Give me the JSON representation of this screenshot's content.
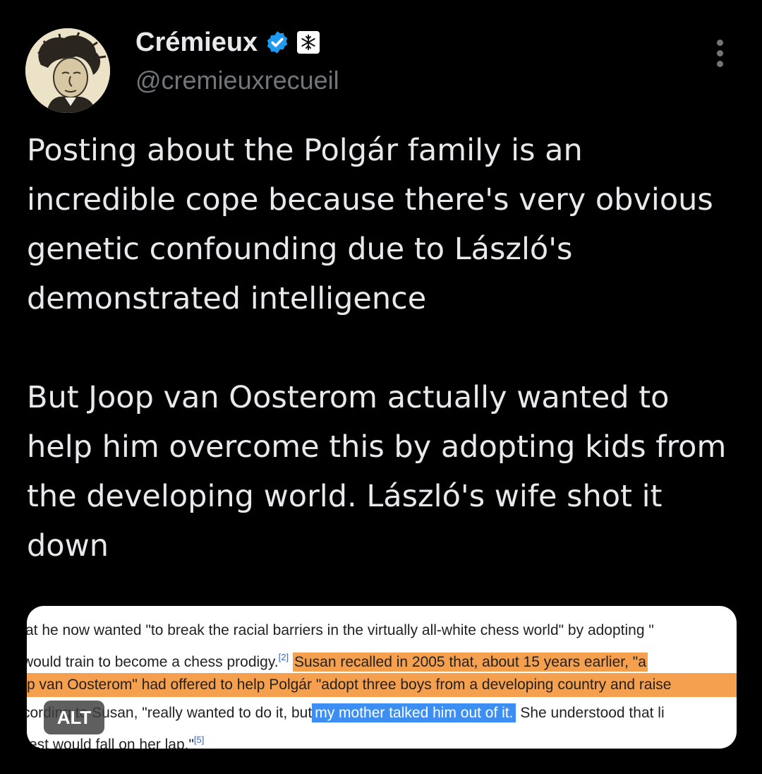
{
  "author": {
    "name": "Crémieux",
    "handle": "@cremieuxrecueil",
    "verified_color": "#1d9bf0",
    "avatar_icon": "caricature-portrait",
    "affiliation_icon": "snowflake-badge-icon"
  },
  "menu_icon": "more-vertical-icon",
  "tweet": {
    "paragraph1": "Posting about the Polgár family is an incredible cope because there's very obvious genetic confounding due to László's demonstrated intelligence",
    "paragraph2": "But Joop van Oosterom actually wanted to help him overcome this by adopting kids from the developing world. László's wife shot it down"
  },
  "media": {
    "alt_badge": "ALT",
    "highlight_orange": "#f5a04f",
    "highlight_blue": "#3d8ef2",
    "lines": {
      "l1": "at he now wanted \"to break the racial barriers in the virtually all-white chess world\" by adopting \"",
      "l2_plain": " would train to become a chess prodigy.",
      "l2_ref": "[2]",
      "l2_highlight": "Susan recalled in 2005 that, about 15 years earlier, \"a",
      "l3": "p van Oosterom\" had offered to help Polgár \"adopt three boys from a developing country and raise",
      "l4_plain": "cording to Susan, \"really wanted to do it, but",
      "l4_highlight": "my mother talked him out of it.",
      "l4_rest": " She understood that li",
      "l5": "rest would fall on her lap.\"",
      "l5_ref": "[5]"
    }
  }
}
